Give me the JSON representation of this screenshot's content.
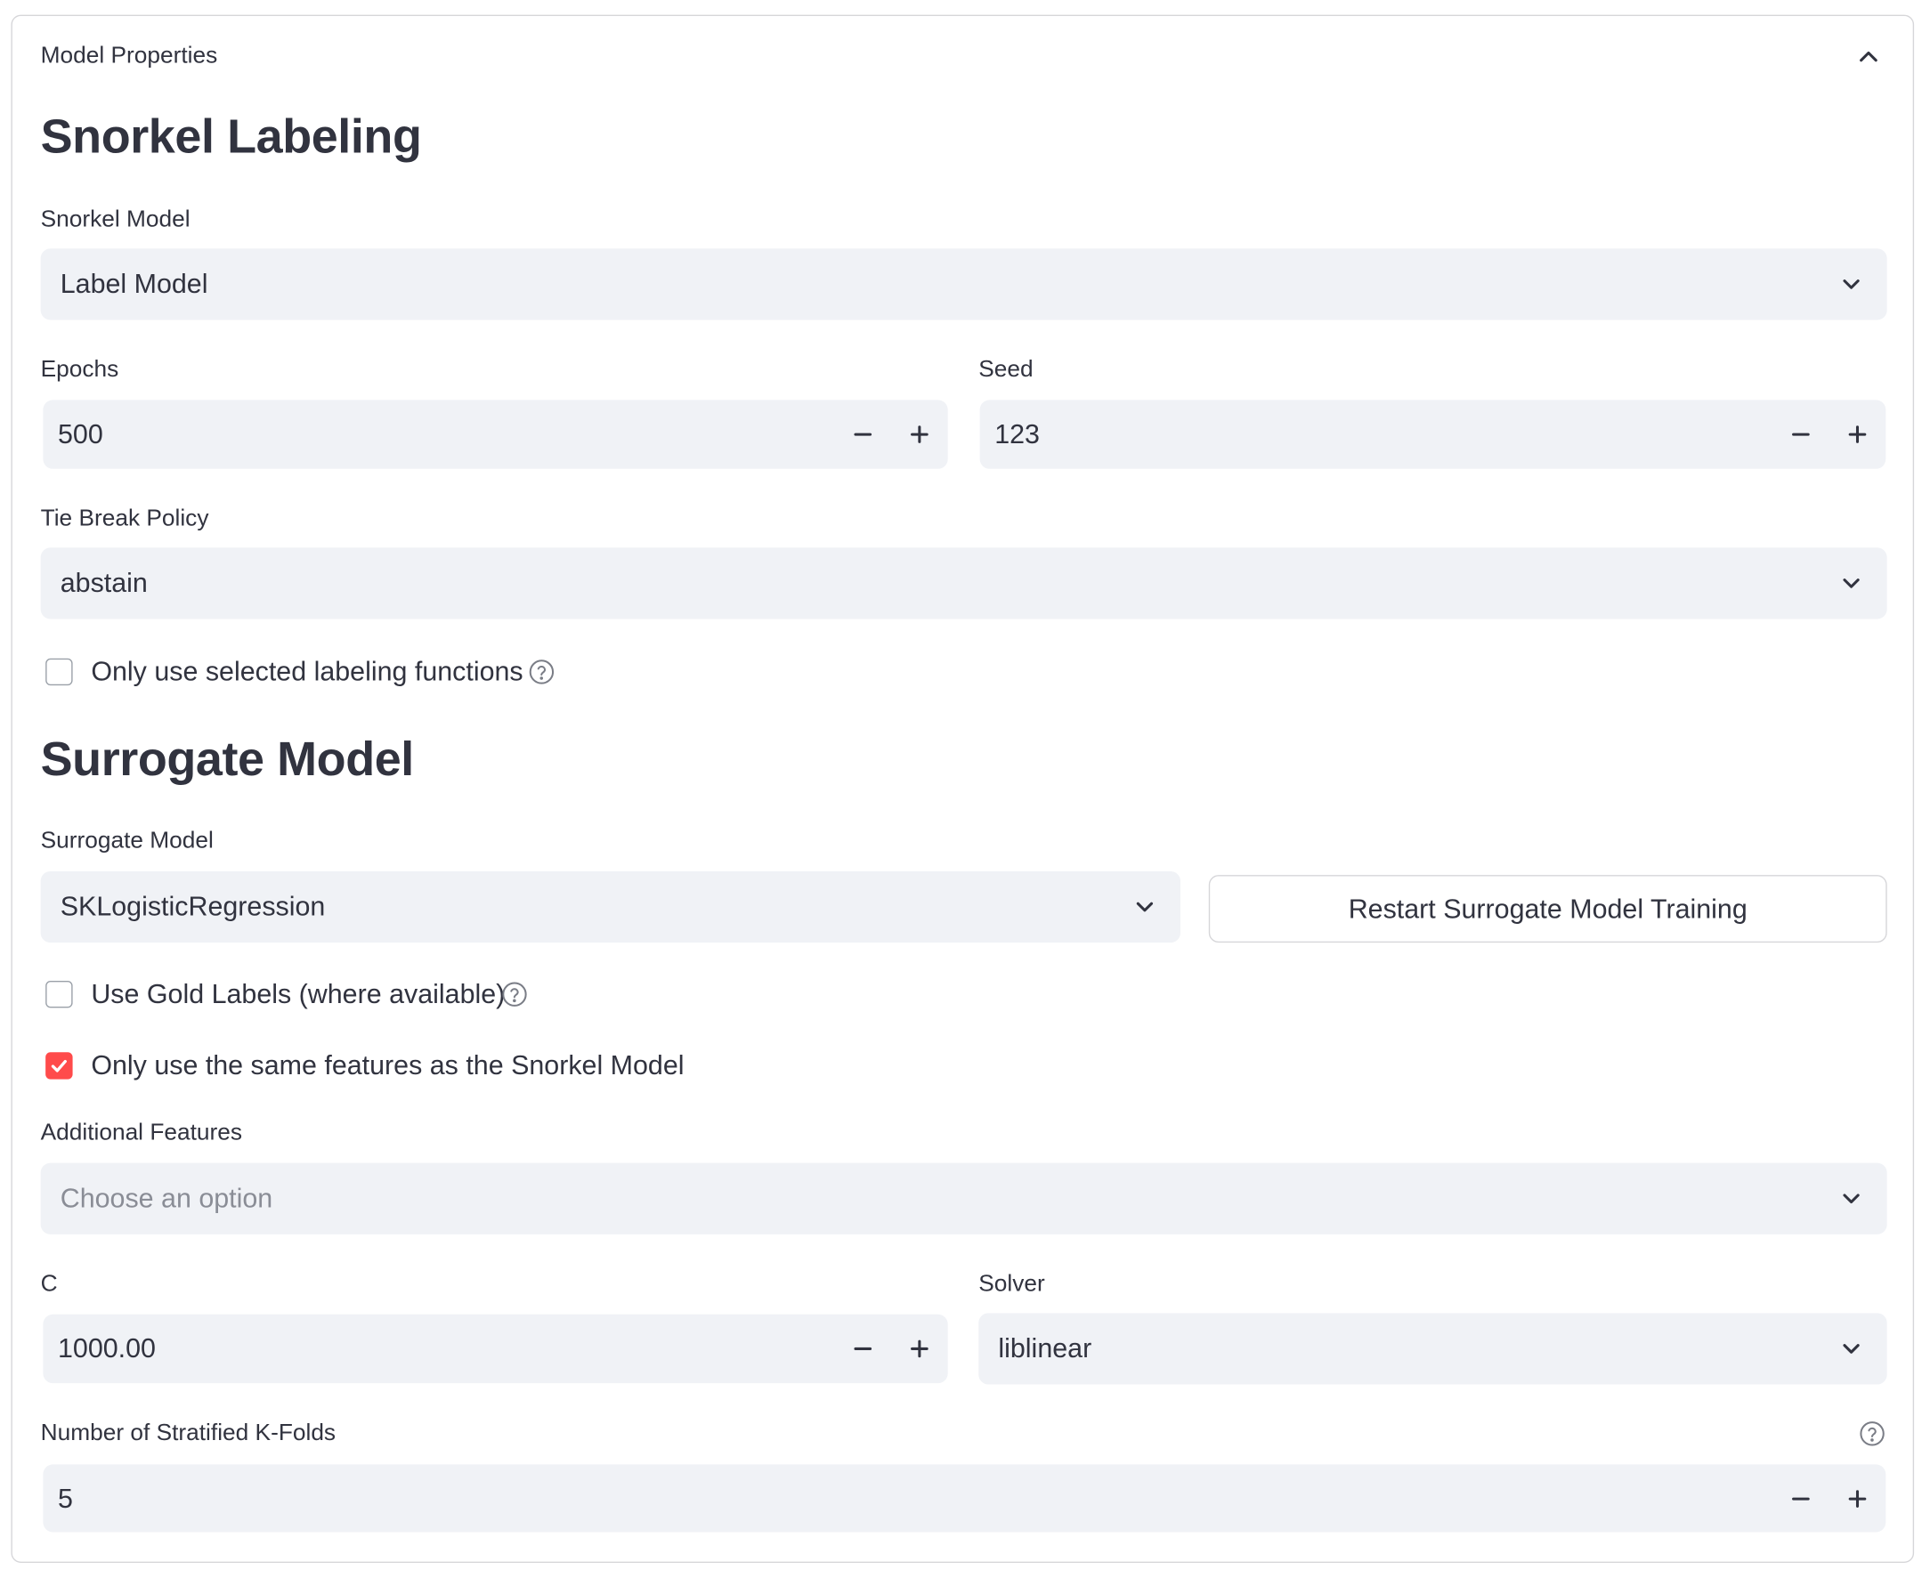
{
  "expander": {
    "title": "Model Properties"
  },
  "snorkel": {
    "heading": "Snorkel Labeling",
    "model_label": "Snorkel Model",
    "model_value": "Label Model",
    "epochs_label": "Epochs",
    "epochs_value": "500",
    "seed_label": "Seed",
    "seed_value": "123",
    "tie_break_label": "Tie Break Policy",
    "tie_break_value": "abstain",
    "only_selected_lf_label": "Only use selected labeling functions",
    "only_selected_lf_checked": false
  },
  "surrogate": {
    "heading": "Surrogate Model",
    "model_label": "Surrogate Model",
    "model_value": "SKLogisticRegression",
    "restart_button": "Restart Surrogate Model Training",
    "gold_labels_label": "Use Gold Labels (where available)",
    "gold_labels_checked": false,
    "same_features_label": "Only use the same features as the Snorkel Model",
    "same_features_checked": true,
    "additional_features_label": "Additional Features",
    "additional_features_placeholder": "Choose an option",
    "c_label": "C",
    "c_value": "1000.00",
    "solver_label": "Solver",
    "solver_value": "liblinear",
    "kfolds_label": "Number of Stratified K-Folds",
    "kfolds_value": "5"
  },
  "colors": {
    "accent": "#ff4b4b",
    "field_bg": "#f0f2f6",
    "text": "#31333f",
    "border": "#d6d6d9"
  },
  "icons": {
    "collapse": "chevron-up-icon",
    "dropdown": "chevron-down-icon",
    "help": "question-circle-icon",
    "minus": "minus-icon",
    "plus": "plus-icon",
    "check": "check-icon"
  }
}
